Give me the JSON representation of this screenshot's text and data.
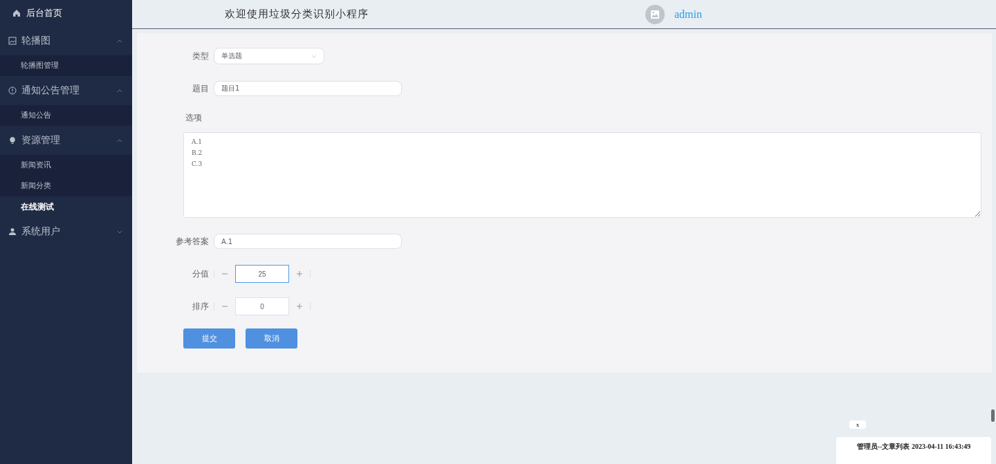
{
  "sidebar": {
    "home": {
      "label": "后台首页"
    },
    "groups": [
      {
        "label": "轮播图",
        "expanded": true,
        "children": [
          {
            "label": "轮播图管理",
            "selected": false
          }
        ]
      },
      {
        "label": "通知公告管理",
        "expanded": true,
        "children": [
          {
            "label": "通知公告",
            "selected": false
          }
        ]
      },
      {
        "label": "资源管理",
        "expanded": true,
        "children": [
          {
            "label": "新闻资讯",
            "selected": false
          },
          {
            "label": "新闻分类",
            "selected": false
          },
          {
            "label": "在线测试",
            "selected": true
          }
        ]
      },
      {
        "label": "系统用户",
        "expanded": false
      }
    ]
  },
  "header": {
    "title": "欢迎使用垃圾分类识别小程序",
    "user": "admin"
  },
  "form": {
    "fields": [
      {
        "kind": "select",
        "label": "类型",
        "value": "单选题"
      },
      {
        "kind": "text",
        "label": "题目",
        "value": "题目1"
      },
      {
        "kind": "textarea",
        "label": "选项",
        "value": "A.1\nB.2\nC.3"
      },
      {
        "kind": "text",
        "label": "参考答案",
        "value": "A.1"
      },
      {
        "kind": "number",
        "label": "分值",
        "value": "25",
        "focused": true
      },
      {
        "kind": "number",
        "label": "排序",
        "value": "0",
        "focused": false
      }
    ],
    "buttons": [
      "提交",
      "取消"
    ]
  },
  "log_popup": {
    "close": "x",
    "entries": [
      "管理员--文章列表 2023-04-11 16:43:49"
    ]
  }
}
